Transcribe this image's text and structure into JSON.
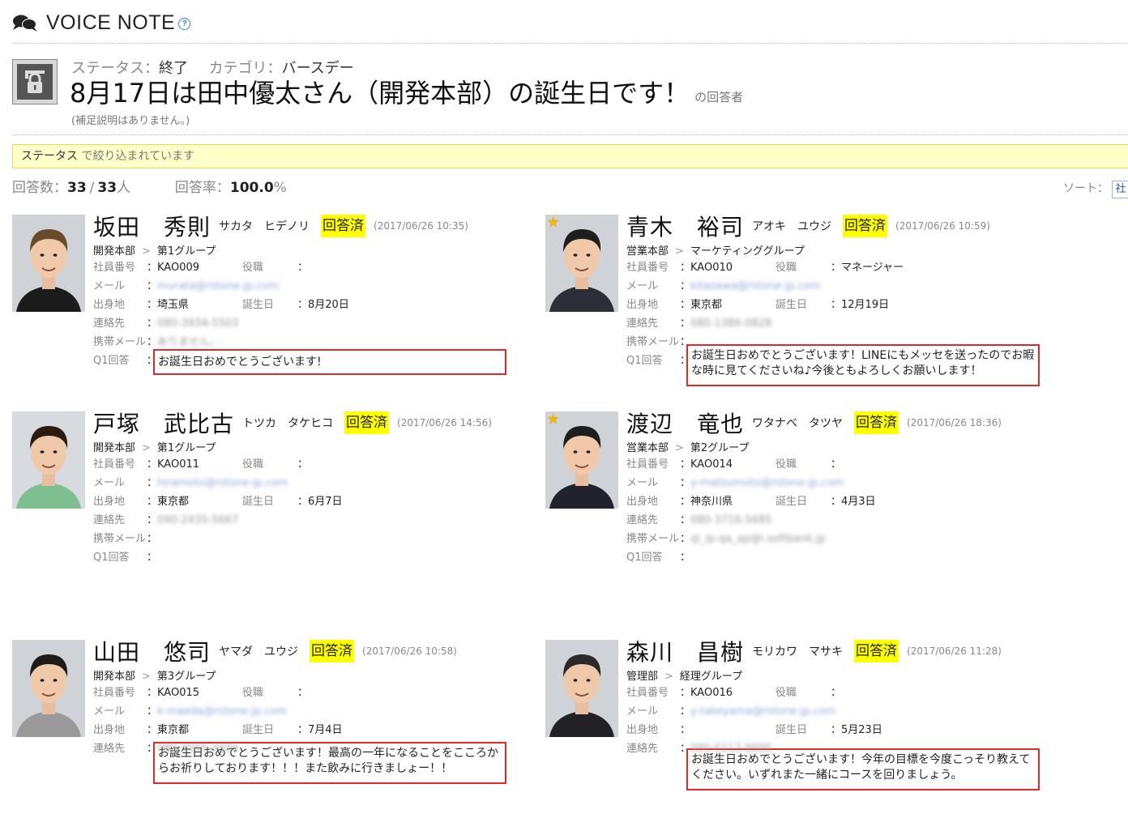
{
  "header": {
    "title": "VOICE NOTE",
    "help_glyph": "?"
  },
  "topic": {
    "status_label": "ステータス：",
    "status_value": "終了",
    "category_label": "カテゴリ：",
    "category_value": "バースデー",
    "title": "8月17日は田中優太さん（開発本部）の誕生日です！",
    "suffix": "の回答者",
    "note": "(補足説明はありません。)"
  },
  "filter": {
    "field": "ステータス",
    "text": " で絞り込まれています"
  },
  "stats": {
    "count_label": "回答数：",
    "answered": "33",
    "sep": "/",
    "total": "33",
    "unit": "人",
    "rate_label": "回答率：",
    "rate": "100.0",
    "rate_unit": "%"
  },
  "sort": {
    "label": "ソート：",
    "value": "社"
  },
  "labels": {
    "emp_no": "社員番号",
    "role": "役職",
    "mail": "メール",
    "origin": "出身地",
    "birthday": "誕生日",
    "contact": "連絡先",
    "mobile": "携帯メール",
    "q1": "Q1回答",
    "colon": "：",
    "gt": ">"
  },
  "colors": {
    "badge": "#ffff00",
    "answer_border": "#e02a2a",
    "filter_bg": "#ffffc8"
  },
  "cards": [
    {
      "name": "坂田　秀則",
      "kana": "サカタ　ヒデノリ",
      "status": "回答済",
      "date": "(2017/06/26 10:35)",
      "dept": "開発本部",
      "group": "第1グループ",
      "emp_no": "KAO009",
      "role": "",
      "mail": "murata@rstone-jp.com",
      "origin": "埼玉県",
      "birthday": "8月20日",
      "contact": "080-3934-5503",
      "mobile": "ありません。",
      "answer": "お誕生日おめでとうございます!",
      "star": false
    },
    {
      "name": "青木　裕司",
      "kana": "アオキ　ユウジ",
      "status": "回答済",
      "date": "(2017/06/26 10:59)",
      "dept": "営業本部",
      "group": "マーケティンググループ",
      "emp_no": "KAO010",
      "role": "マネージャー",
      "mail": "kitazawa@rstone-jp.com",
      "origin": "東京都",
      "birthday": "12月19日",
      "contact": "080-1386-0828",
      "mobile": "",
      "answer": "お誕生日おめでとうございます！LINEにもメッセを送ったのでお暇な時に見てくださいね♪今後ともよろしくお願いします！",
      "star": true
    },
    {
      "name": "戸塚　武比古",
      "kana": "トツカ　タケヒコ",
      "status": "回答済",
      "date": "(2017/06/26 14:56)",
      "dept": "開発本部",
      "group": "第1グループ",
      "emp_no": "KAO011",
      "role": "",
      "mail": "hiramoto@rstone-jp.com",
      "origin": "東京都",
      "birthday": "6月7日",
      "contact": "090-2435-5667",
      "mobile": "",
      "answer": "お誕生日おめでとうございます！最高の一年になることをこころからお祈りしております！！！また飲みに行きましょー！！",
      "star": false
    },
    {
      "name": "渡辺　竜也",
      "kana": "ワタナベ　タツヤ",
      "status": "回答済",
      "date": "(2017/06/26 18:36)",
      "dept": "営業本部",
      "group": "第2グループ",
      "emp_no": "KAO014",
      "role": "",
      "mail": "y-matsumoto@rstone-jp.com",
      "origin": "神奈川県",
      "birthday": "4月3日",
      "contact": "080-3716-5685",
      "mobile": "qi_ip-qa_ap@i.softbank.jp",
      "answer": "お誕生日おめでとうございます！今年の目標を今度こっそり教えてください。いずれまた一緒にコースを回りましょう。",
      "star": true
    },
    {
      "name": "山田　悠司",
      "kana": "ヤマダ　ユウジ",
      "status": "回答済",
      "date": "(2017/06/26 10:58)",
      "dept": "開発本部",
      "group": "第3グループ",
      "emp_no": "KAO015",
      "role": "",
      "mail": "k-maeda@rstone-jp.com",
      "origin": "東京都",
      "birthday": "7月4日",
      "contact": "080-3565-3594",
      "mobile": "",
      "answer": "",
      "star": false
    },
    {
      "name": "森川　昌樹",
      "kana": "モリカワ　マサキ",
      "status": "回答済",
      "date": "(2017/06/26 11:28)",
      "dept": "管理部",
      "group": "経理グループ",
      "emp_no": "KAO016",
      "role": "",
      "mail": "y-takeyama@rstone-jp.com",
      "origin": "",
      "birthday": "5月23日",
      "contact": "090-6113-8695",
      "mobile": "",
      "answer": "",
      "star": false
    }
  ]
}
